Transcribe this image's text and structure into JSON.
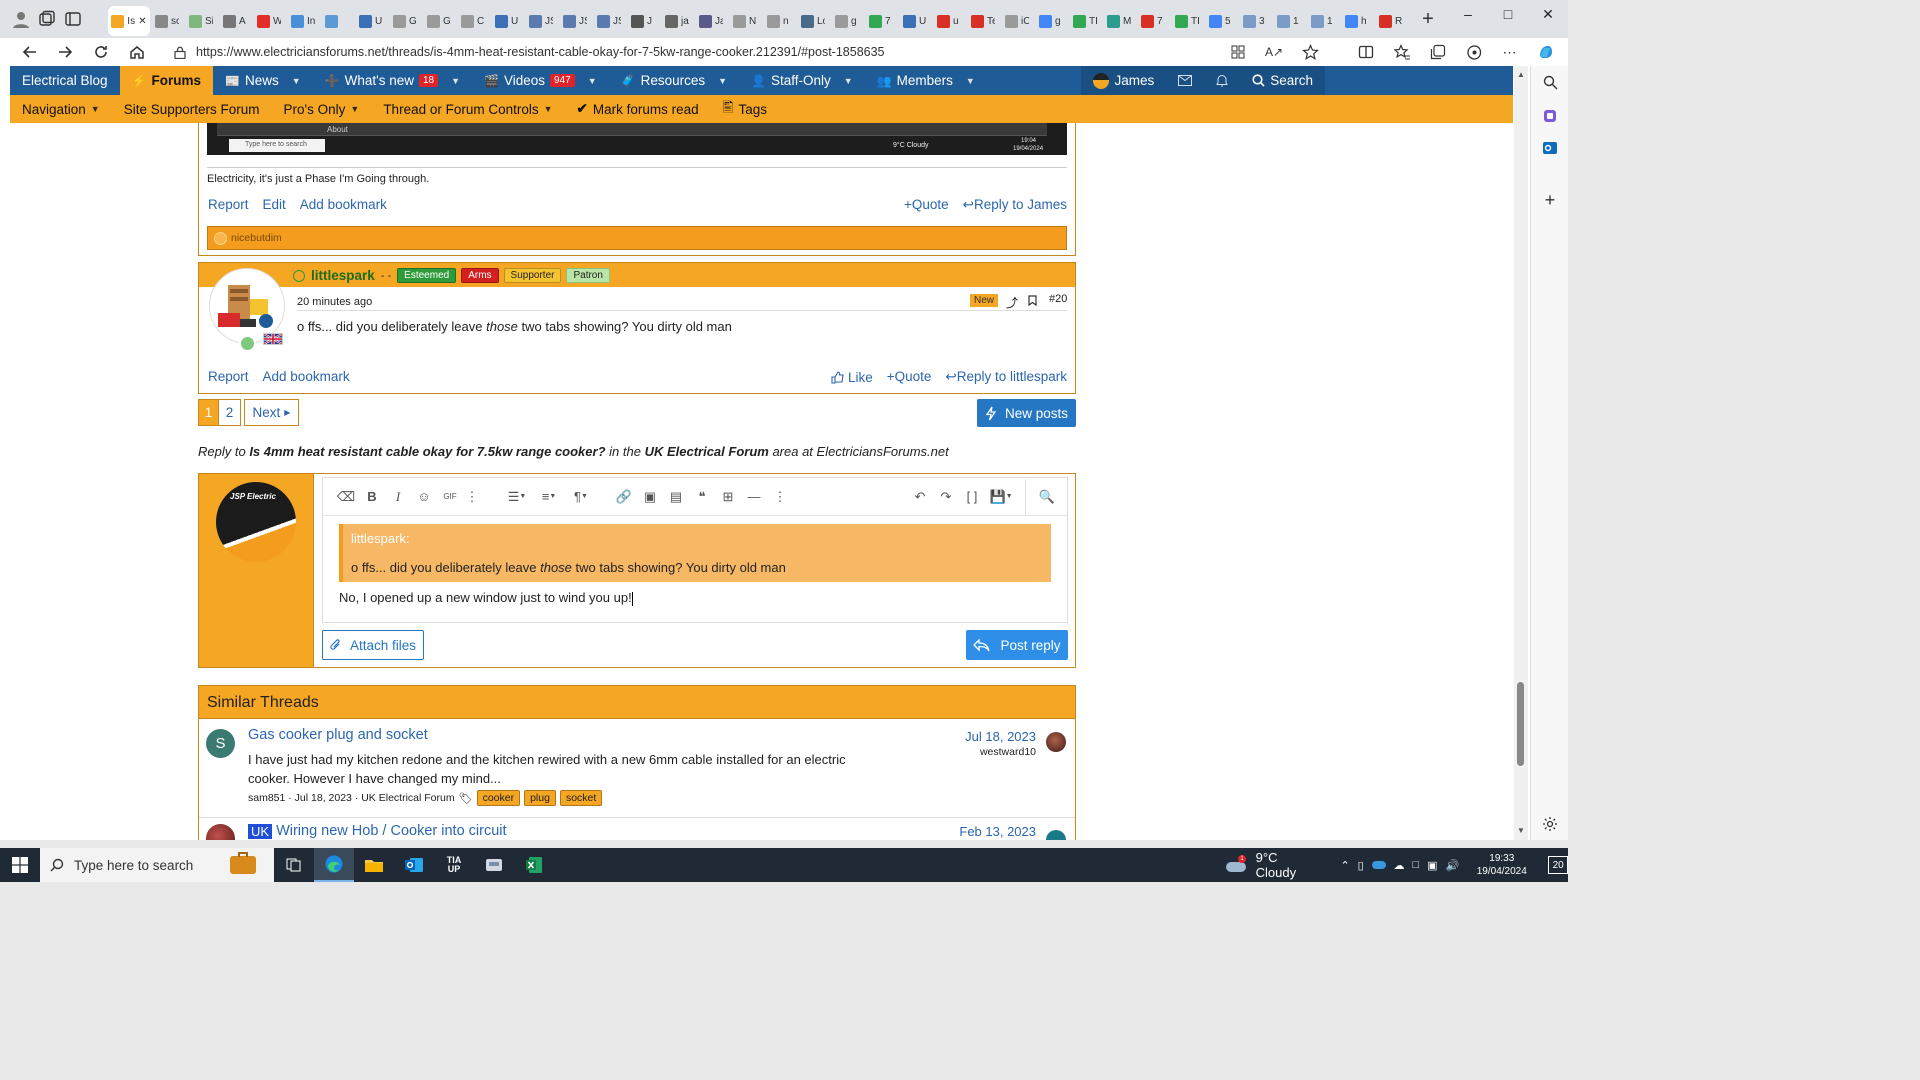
{
  "browser": {
    "tabs": [
      {
        "label": "Is",
        "color": "#f5a623",
        "active": true
      },
      {
        "label": "sc",
        "color": "#888888"
      },
      {
        "label": "Si",
        "color": "#7fb77e"
      },
      {
        "label": "A",
        "color": "#777777"
      },
      {
        "label": "W",
        "color": "#e52d27"
      },
      {
        "label": "In",
        "color": "#4a90d9"
      },
      {
        "label": "",
        "color": "#5b9bd5"
      },
      {
        "label": "U",
        "color": "#3b6fb6"
      },
      {
        "label": "G",
        "color": "#9a9a9a"
      },
      {
        "label": "G",
        "color": "#9a9a9a"
      },
      {
        "label": "C",
        "color": "#9a9a9a"
      },
      {
        "label": "U",
        "color": "#3b6fb6"
      },
      {
        "label": "JS",
        "color": "#5a7bb0"
      },
      {
        "label": "JS",
        "color": "#5a7bb0"
      },
      {
        "label": "JS",
        "color": "#5a7bb0"
      },
      {
        "label": "J",
        "color": "#555555"
      },
      {
        "label": "ja",
        "color": "#666666"
      },
      {
        "label": "Ja",
        "color": "#5a5a8a"
      },
      {
        "label": "N",
        "color": "#9a9a9a"
      },
      {
        "label": "n",
        "color": "#9a9a9a"
      },
      {
        "label": "Lo",
        "color": "#4a6a8a"
      },
      {
        "label": "g",
        "color": "#9a9a9a"
      },
      {
        "label": "7",
        "color": "#33a852"
      },
      {
        "label": "U",
        "color": "#3b6fb6"
      },
      {
        "label": "u",
        "color": "#d93025"
      },
      {
        "label": "Te",
        "color": "#d93025"
      },
      {
        "label": "iC",
        "color": "#9a9a9a"
      },
      {
        "label": "g",
        "color": "#4285f4"
      },
      {
        "label": "TI",
        "color": "#33a852"
      },
      {
        "label": "M",
        "color": "#2a9d8f"
      },
      {
        "label": "7",
        "color": "#d93025"
      },
      {
        "label": "TI",
        "color": "#33a852"
      },
      {
        "label": "5",
        "color": "#4285f4"
      },
      {
        "label": "3",
        "color": "#7a9cc6"
      },
      {
        "label": "1",
        "color": "#7a9cc6"
      },
      {
        "label": "1",
        "color": "#7a9cc6"
      },
      {
        "label": "h",
        "color": "#4285f4"
      },
      {
        "label": "R",
        "color": "#d93025"
      }
    ],
    "url": "https://www.electriciansforums.net/threads/is-4mm-heat-resistant-cable-okay-for-7-5kw-range-cooker.212391/#post-1858635"
  },
  "forum_nav": {
    "items": [
      {
        "label": "Electrical Blog"
      },
      {
        "label": "Forums",
        "selected": true
      },
      {
        "label": "News",
        "caret": true
      },
      {
        "label": "What's new",
        "badge": "18",
        "caret": true
      },
      {
        "label": "Videos",
        "badge": "947",
        "caret": true
      },
      {
        "label": "Resources",
        "caret": true
      },
      {
        "label": "Staff-Only",
        "caret": true
      },
      {
        "label": "Members",
        "caret": true
      }
    ],
    "user": "James",
    "search": "Search"
  },
  "sub_nav": {
    "navigation": "Navigation",
    "site_supporters": "Site Supporters Forum",
    "pros_only": "Pro's Only",
    "thread_controls": "Thread or Forum Controls",
    "mark_read": "Mark forums read",
    "tags": "Tags"
  },
  "prev_post": {
    "screenshot": {
      "taskbar_search": "Type here to search",
      "weather": "9°C  Cloudy",
      "time": "19:04",
      "date": "19/04/2024",
      "label": "About"
    },
    "signature": "Electricity, it's just a Phase I'm Going through.",
    "actions": {
      "report": "Report",
      "edit": "Edit",
      "bookmark": "Add bookmark",
      "quote": "Quote",
      "reply": "Reply to James"
    },
    "reaction_user": "nicebutdim"
  },
  "post20": {
    "username": "littlespark",
    "separator": "- -",
    "banners": [
      {
        "label": "Esteemed",
        "bg": "#2e9b3a",
        "fg": "#ffffff",
        "border": "#1d7028"
      },
      {
        "label": "Arms",
        "bg": "#d22020",
        "fg": "#ffffff",
        "border": "#9a1515"
      },
      {
        "label": "Supporter",
        "bg": "#f5c330",
        "fg": "#222222",
        "border": "#b8901e"
      },
      {
        "label": "Patron",
        "bg": "#b9e6a8",
        "fg": "#222222",
        "border": "#8ec27c"
      }
    ],
    "time": "20 minutes ago",
    "new_badge": "New",
    "number": "#20",
    "body_pre": "o ffs... did you deliberately leave ",
    "body_em": "those",
    "body_post": " two tabs showing? You dirty old man",
    "actions": {
      "report": "Report",
      "bookmark": "Add bookmark",
      "like": "Like",
      "quote": "Quote",
      "reply": "Reply to littlespark"
    }
  },
  "pagination": {
    "page1": "1",
    "page2": "2",
    "next": "Next",
    "new_posts": "New posts"
  },
  "reply_line": {
    "prefix": "Reply to ",
    "thread": "Is 4mm heat resistant cable okay for 7.5kw range cooker?",
    "mid": " in the ",
    "forum": "UK Electrical Forum",
    "suffix": " area at ElectriciansForums.net"
  },
  "editor": {
    "avatar_text": "JSP Electric",
    "quote_author": "littlespark:",
    "quote_pre": "o ffs... did you deliberately leave ",
    "quote_em": "those",
    "quote_post": " two tabs showing? You dirty old man",
    "content": "No, I opened up a new window just to wind you up!",
    "attach": "Attach files",
    "post_reply": "Post reply"
  },
  "similar": {
    "title": "Similar Threads",
    "threads": [
      {
        "avatar_letter": "S",
        "title": "Gas cooker plug and socket",
        "snippet": "I have just had my kitchen redone and the kitchen rewired with a new 6mm cable installed for an electric cooker. However I have changed my mind...",
        "meta": "sam851 · Jul 18, 2023 · UK Electrical Forum",
        "tags": [
          "cooker",
          "plug",
          "socket"
        ],
        "date": "Jul 18, 2023",
        "last_user": "westward10"
      },
      {
        "prefix": "UK",
        "title": "Wiring new Hob / Cooker into circuit",
        "date": "Feb 13, 2023"
      }
    ]
  },
  "taskbar": {
    "search": "Type here to search",
    "weather": "9°C  Cloudy",
    "time": "19:33",
    "date": "19/04/2024",
    "notif": "20"
  },
  "colors": {
    "forum_blue": "#1f5c97",
    "forum_orange": "#f5a623",
    "link": "#2c66b0",
    "button_blue": "#2577c4"
  }
}
